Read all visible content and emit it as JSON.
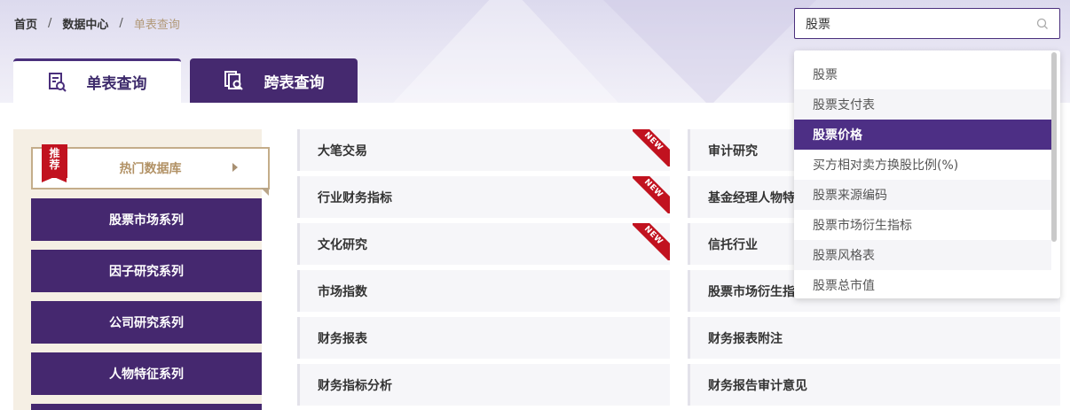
{
  "breadcrumb": {
    "home": "首页",
    "sep1": "/",
    "data_center": "数据中心",
    "sep2": "/",
    "current": "单表查询"
  },
  "tabs": {
    "single": "单表查询",
    "cross": "跨表查询"
  },
  "search": {
    "value": "股票"
  },
  "left_panel": {
    "badge_line1": "推",
    "badge_line2": "荐",
    "hot_label": "热门数据库",
    "series": [
      "股票市场系列",
      "因子研究系列",
      "公司研究系列",
      "人物特征系列"
    ]
  },
  "cards": {
    "col1": [
      "大笔交易",
      "行业财务指标",
      "文化研究",
      "市场指数",
      "财务报表",
      "财务指标分析"
    ],
    "col2": [
      "审计研究",
      "基金经理人物特",
      "信托行业",
      "股票市场衍生指",
      "财务报表附注",
      "财务报告审计意见"
    ],
    "new_label": "NEW"
  },
  "dropdown": {
    "items": [
      "股票",
      "股票支付表",
      "股票价格",
      "买方相对卖方换股比例(%)",
      "股票来源编码",
      "股票市场衍生指标",
      "股票风格表",
      "股票总市值"
    ],
    "active_index": 2
  },
  "colors": {
    "brand_purple": "#45286f",
    "accent_gold": "#b29266",
    "badge_red": "#c1121f"
  }
}
